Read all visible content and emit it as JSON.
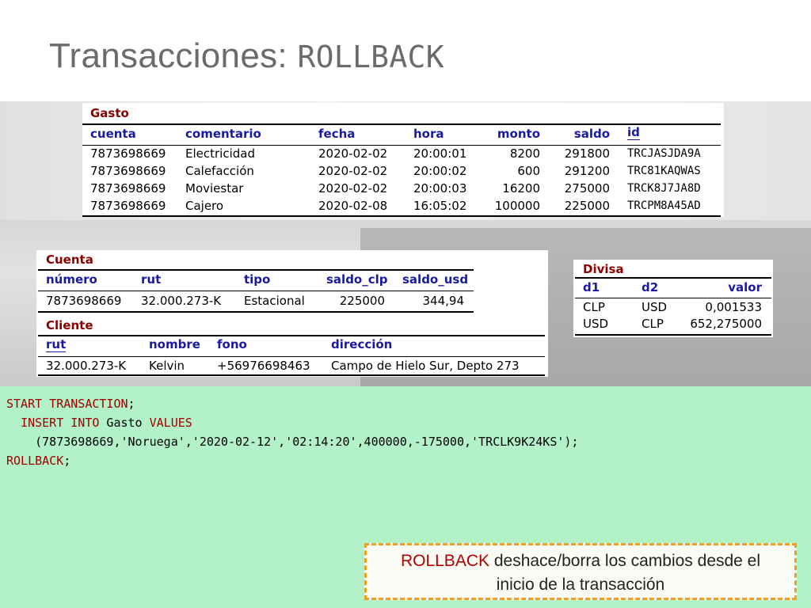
{
  "title": {
    "prefix": "Transacciones: ",
    "keyword": "ROLLBACK"
  },
  "gasto": {
    "name": "Gasto",
    "headers": [
      "cuenta",
      "comentario",
      "fecha",
      "hora",
      "monto",
      "saldo",
      "id"
    ],
    "rows": [
      [
        "7873698669",
        "Electricidad",
        "2020-02-02",
        "20:00:01",
        "8200",
        "291800",
        "TRCJASJDA9A"
      ],
      [
        "7873698669",
        "Calefacción",
        "2020-02-02",
        "20:00:02",
        "600",
        "291200",
        "TRC81KAQWAS"
      ],
      [
        "7873698669",
        "Moviestar",
        "2020-02-02",
        "20:00:03",
        "16200",
        "275000",
        "TRCK8J7JA8D"
      ],
      [
        "7873698669",
        "Cajero",
        "2020-02-08",
        "16:05:02",
        "100000",
        "225000",
        "TRCPM8A45AD"
      ]
    ]
  },
  "cuenta": {
    "name": "Cuenta",
    "headers": [
      "número",
      "rut",
      "tipo",
      "saldo_clp",
      "saldo_usd"
    ],
    "rows": [
      [
        "7873698669",
        "32.000.273-K",
        "Estacional",
        "225000",
        "344,94"
      ]
    ]
  },
  "cliente": {
    "name": "Cliente",
    "headers": [
      "rut",
      "nombre",
      "fono",
      "dirección"
    ],
    "rows": [
      [
        "32.000.273-K",
        "Kelvin",
        "+56976698463",
        "Campo de Hielo Sur, Depto 273"
      ]
    ]
  },
  "divisa": {
    "name": "Divisa",
    "headers": [
      "d1",
      "d2",
      "valor"
    ],
    "rows": [
      [
        "CLP",
        "USD",
        "0,001533"
      ],
      [
        "USD",
        "CLP",
        "652,275000"
      ]
    ]
  },
  "code": {
    "line1_kw": "START TRANSACTION",
    "line1_end": ";",
    "line2_kw1": "INSERT INTO",
    "line2_mid": " Gasto ",
    "line2_kw2": "VALUES",
    "line3": "(7873698669,'Noruega','2020-02-12','02:14:20',400000,-175000,'TRCLK9K24KS');",
    "line4_kw": "ROLLBACK",
    "line4_end": ";"
  },
  "callout": {
    "keyword": "ROLLBACK",
    "text1": " deshace/borra los cambios desde el",
    "text2": "inicio de la transacción"
  },
  "colors": {
    "keyword": "#a00000",
    "header": "#1a1aa0",
    "code_bg": "#b3f1c9",
    "callout_border": "#f0a020"
  }
}
